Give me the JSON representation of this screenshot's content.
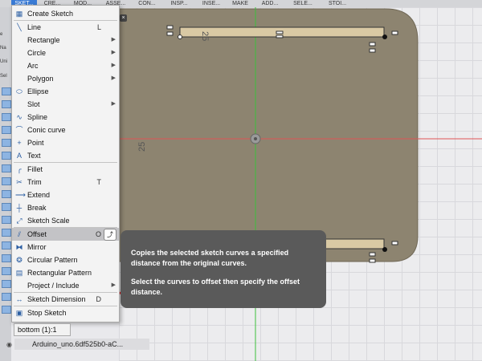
{
  "toolbar": {
    "tabs": [
      {
        "label": "SKET...",
        "active": true
      },
      {
        "label": "CRE...",
        "active": false
      },
      {
        "label": "MOD...",
        "active": false
      },
      {
        "label": "ASSE...",
        "active": false
      },
      {
        "label": "CON...",
        "active": false
      },
      {
        "label": "INSP...",
        "active": false
      },
      {
        "label": "INSE...",
        "active": false
      },
      {
        "label": "MAKE",
        "active": false
      },
      {
        "label": "ADD...",
        "active": false
      },
      {
        "label": "SELE...",
        "active": false
      },
      {
        "label": "STOI...",
        "active": false
      }
    ]
  },
  "left_panel": {
    "items": [
      "e",
      "Na",
      "Uni",
      "Sel"
    ]
  },
  "menu": {
    "items": [
      {
        "label": "Create Sketch",
        "icon": "create-sketch-icon",
        "glyph": "▦"
      },
      {
        "label": "Line",
        "icon": "line-icon",
        "glyph": "╲",
        "shortcut": "L"
      },
      {
        "label": "Rectangle",
        "icon": "",
        "submenu": true
      },
      {
        "label": "Circle",
        "icon": "",
        "submenu": true
      },
      {
        "label": "Arc",
        "icon": "",
        "submenu": true
      },
      {
        "label": "Polygon",
        "icon": "",
        "submenu": true
      },
      {
        "label": "Ellipse",
        "icon": "ellipse-icon",
        "glyph": "⬭"
      },
      {
        "label": "Slot",
        "icon": "",
        "submenu": true
      },
      {
        "label": "Spline",
        "icon": "spline-icon",
        "glyph": "∿"
      },
      {
        "label": "Conic curve",
        "icon": "conic-curve-icon",
        "glyph": "⌒"
      },
      {
        "label": "Point",
        "icon": "point-icon",
        "glyph": "+"
      },
      {
        "label": "Text",
        "icon": "text-icon",
        "glyph": "A"
      },
      {
        "label": "Fillet",
        "icon": "fillet-icon",
        "glyph": "╭"
      },
      {
        "label": "Trim",
        "icon": "trim-icon",
        "glyph": "✂",
        "shortcut": "T"
      },
      {
        "label": "Extend",
        "icon": "extend-icon",
        "glyph": "⟶"
      },
      {
        "label": "Break",
        "icon": "break-icon",
        "glyph": "┼"
      },
      {
        "label": "Sketch Scale",
        "icon": "sketch-scale-icon",
        "glyph": "⤢"
      },
      {
        "label": "Offset",
        "icon": "offset-icon",
        "glyph": "⫽",
        "shortcut": "O",
        "highlighted": true
      },
      {
        "label": "Mirror",
        "icon": "mirror-icon",
        "glyph": "⧓"
      },
      {
        "label": "Circular Pattern",
        "icon": "circular-pattern-icon",
        "glyph": "❂"
      },
      {
        "label": "Rectangular Pattern",
        "icon": "rectangular-pattern-icon",
        "glyph": "▤"
      },
      {
        "label": "Project / Include",
        "icon": "",
        "submenu": true
      },
      {
        "label": "Sketch Dimension",
        "icon": "sketch-dimension-icon",
        "glyph": "↔",
        "shortcut": "D"
      },
      {
        "label": "Stop Sketch",
        "icon": "stop-sketch-icon",
        "glyph": "▣"
      }
    ]
  },
  "tooltip": {
    "line1": "Copies the selected sketch curves a specified distance from the original curves.",
    "line2": "Select the curves to offset then specify the offset distance."
  },
  "canvas": {
    "dimension_top": "25",
    "dimension_left": "25",
    "close_glyph": "×"
  },
  "browser": {
    "bottom_label": "bottom (1):1",
    "file_label": "Arduino_uno.6df525b0-aC..."
  },
  "colors": {
    "plate": "#8d8470",
    "plate_edge": "#706856",
    "rail": "#d9c9a4",
    "axis_green": "#3cbf3c",
    "axis_red": "#e05555",
    "tooltip_bg": "#5a5a5a",
    "arrow": "#e8141b"
  }
}
